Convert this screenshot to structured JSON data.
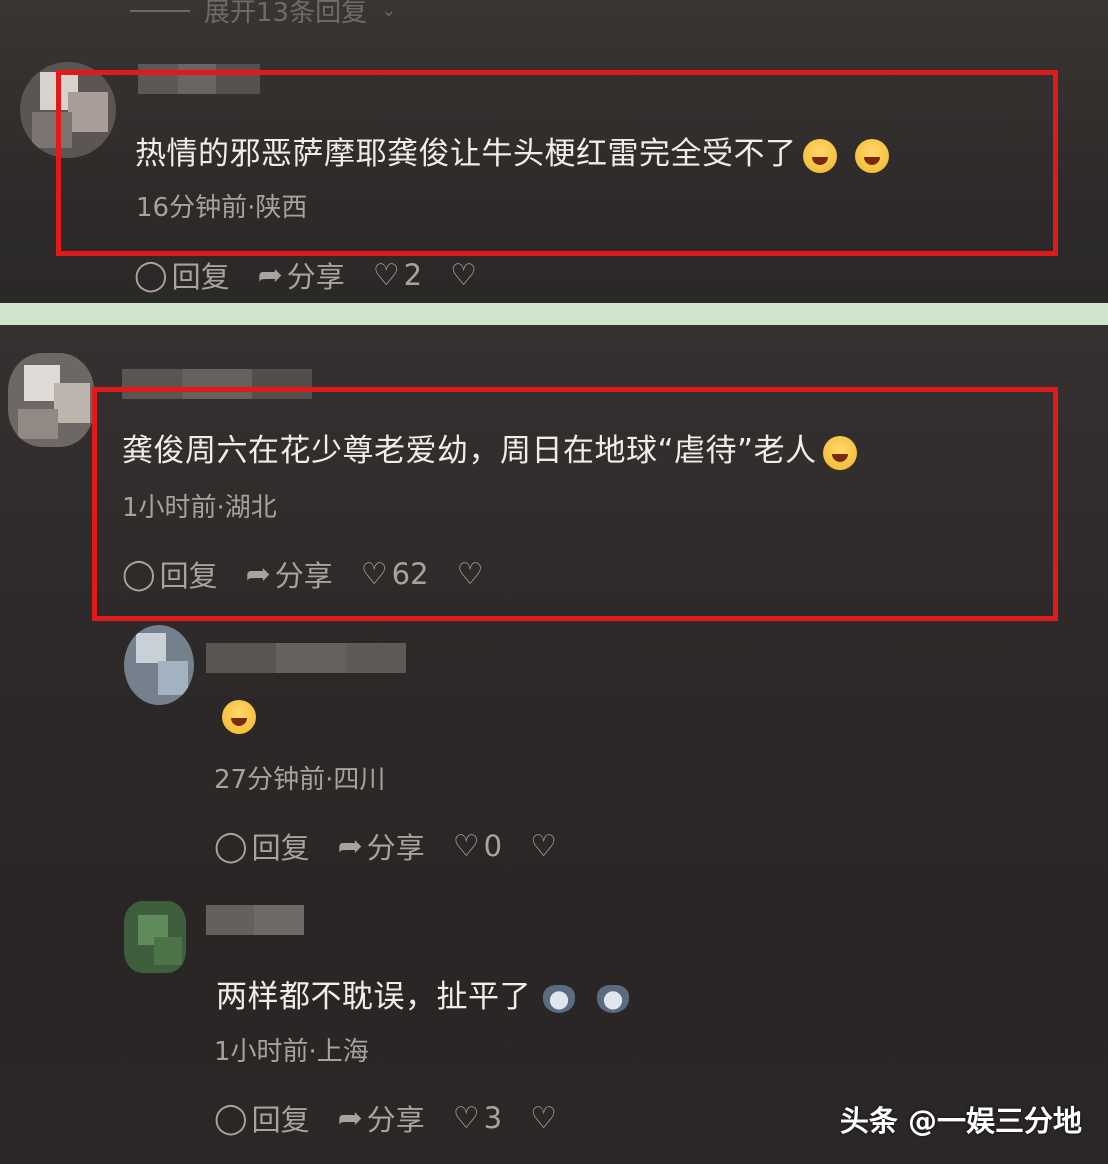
{
  "thread": {
    "expand_label": "展开13条回复"
  },
  "comments": [
    {
      "text": "热情的邪恶萨摩耶龚俊让牛头梗红雷完全受不了",
      "meta": "16分钟前·陕西",
      "reply_label": "回复",
      "share_label": "分享",
      "like_count": "2",
      "emojis": [
        "laugh-emoji",
        "tears-of-joy-emoji"
      ]
    },
    {
      "text": "龚俊周六在花少尊老爱幼，周日在地球“虐待”老人",
      "meta": "1小时前·湖北",
      "reply_label": "回复",
      "share_label": "分享",
      "like_count": "62",
      "emojis": [
        "tears-of-joy-emoji"
      ]
    },
    {
      "text": "",
      "meta": "27分钟前·四川",
      "reply_label": "回复",
      "share_label": "分享",
      "like_count": "0",
      "emojis": [
        "tears-of-joy-emoji"
      ]
    },
    {
      "text": "两样都不耽误，扯平了",
      "meta": "1小时前·上海",
      "reply_label": "回复",
      "share_label": "分享",
      "like_count": "3",
      "emojis": [
        "cat-emoji",
        "cat-emoji"
      ]
    }
  ],
  "watermark": "头条 @一娱三分地",
  "colors": {
    "highlight": "#e0191b",
    "divider": "#cfe6cc",
    "background": "#2a2727"
  }
}
